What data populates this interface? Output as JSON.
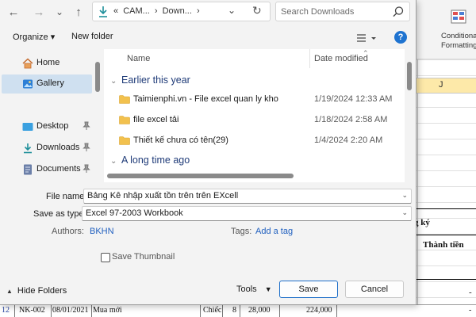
{
  "excel": {
    "ribbon_label_line1": "Conditional",
    "ribbon_label_line2": "Formatting",
    "column_letter": "J",
    "header_fragment": "g ký",
    "column_title": "Thành tiền",
    "dash1": "-",
    "dash2": "-",
    "bottom_row": {
      "row_num": "12",
      "code": "NK-002",
      "date": "08/01/2021",
      "desc": "Mua mới",
      "unit": "Chiếc",
      "qty": "8",
      "price": "28,000",
      "total": "224,000",
      "dash": "-"
    }
  },
  "nav": {
    "back_icon": "←",
    "forward_icon": "→",
    "recent_icon": "⌄",
    "up_icon": "↑",
    "address": {
      "prefix": "«",
      "crumb1": "CAM...",
      "sep": "›",
      "crumb2": "Down...",
      "sep2": "›"
    },
    "search_placeholder": "Search Downloads"
  },
  "toolbar": {
    "organize_label": "Organize ▾",
    "new_folder_label": "New folder",
    "help_label": "?"
  },
  "sidebar": {
    "items": [
      {
        "label": "Home"
      },
      {
        "label": "Gallery"
      },
      {
        "label": "Desktop"
      },
      {
        "label": "Downloads"
      },
      {
        "label": "Documents"
      }
    ]
  },
  "files": {
    "col_name": "Name",
    "col_date": "Date modified",
    "group1": "Earlier this year",
    "group2": "A long time ago",
    "rows": [
      {
        "name": "Taimienphi.vn - File excel quan ly kho",
        "date": "1/19/2024 12:33 AM"
      },
      {
        "name": "file excel tải",
        "date": "1/18/2024 2:58 AM"
      },
      {
        "name": "Thiết kế chưa có tên(29)",
        "date": "1/4/2024 2:20 AM"
      }
    ]
  },
  "form": {
    "file_name_label": "File name:",
    "file_name_value": "Bảng Kê nhập xuất tồn trên trên EXcell",
    "save_type_label": "Save as type:",
    "save_type_value": "Excel 97-2003 Workbook",
    "authors_label": "Authors:",
    "authors_value": "BKHN",
    "tags_label": "Tags:",
    "tags_value": "Add a tag",
    "thumbnail_label": "Save Thumbnail"
  },
  "footer": {
    "hide_folders_label": "Hide Folders",
    "tools_label": "Tools",
    "save_label": "Save",
    "cancel_label": "Cancel"
  },
  "colors": {
    "accent": "#1e6fc9",
    "selected_bg": "#cfe0f0",
    "group_text": "#1f3b78",
    "folder": "#f2c14e"
  }
}
